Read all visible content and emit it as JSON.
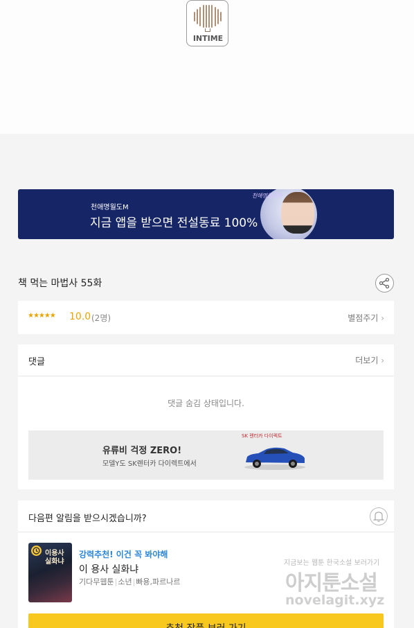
{
  "header": {
    "logo_text": "INTIME"
  },
  "banner_ad": {
    "small_text": "천애명월도M",
    "main_text": "지금 앱을 받으면 전설동료 100%",
    "game_logo": "천애명월도M"
  },
  "episode": {
    "title": "책 먹는 마법사 55화"
  },
  "rating": {
    "stars": "★★★★★",
    "score": "10.0",
    "votes": "(2명)",
    "rate_link": "별점주기"
  },
  "comments": {
    "label": "댓글",
    "more_link": "더보기",
    "hidden_message": "댓글 숨김 상태입니다.",
    "ad": {
      "headline": "유류비 걱정 ZERO!",
      "subtext": "모델Y도 SK렌터카 다이렉트에서",
      "brand": "SK 렌터카 다이렉트"
    }
  },
  "notify": {
    "question": "다음편 알림을 받으시겠습니까?",
    "recommend": {
      "tag": "강력추천! 이건 꼭 봐야해",
      "title": "이 용사 실화냐",
      "thumb_title": "이용사\n실화냐",
      "meta": [
        "기다무웹툰",
        "소년",
        "빠용,파르나르"
      ],
      "button_label": "추천 작품 보러 가기"
    }
  },
  "watermark": {
    "top_line": "지금보는 웹툰 한국소설 보러가기",
    "main": "아지툰소설",
    "url": "novelagit.xyz"
  },
  "colors": {
    "accent_yellow": "#f8c81e",
    "star": "#e8a300",
    "link_blue": "#2c86d8",
    "banner_bg": "#162566"
  },
  "icons": [
    "share-icon",
    "chevron-right-icon",
    "bell-icon",
    "clock-icon"
  ]
}
